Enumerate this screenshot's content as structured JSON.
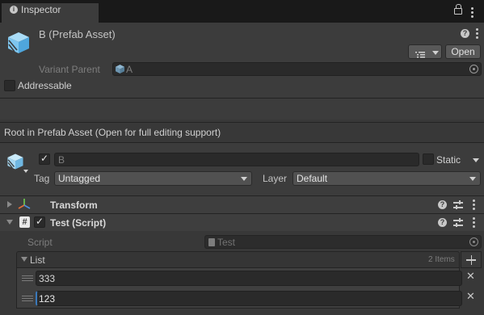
{
  "tab": {
    "title": "Inspector"
  },
  "header": {
    "title": "B (Prefab Asset)",
    "variant_parent_label": "Variant Parent",
    "variant_parent_value": "A",
    "open_button": "Open",
    "addressable_label": "Addressable"
  },
  "notice": "Root in Prefab Asset (Open for full editing support)",
  "gameobject": {
    "name": "B",
    "static_label": "Static",
    "tag_label": "Tag",
    "tag_value": "Untagged",
    "layer_label": "Layer",
    "layer_value": "Default"
  },
  "components": {
    "transform": {
      "title": "Transform"
    },
    "script": {
      "title": "Test (Script)",
      "script_label": "Script",
      "script_value": "Test",
      "list_label": "List",
      "list_count": "2 Items",
      "items": [
        "333",
        "123"
      ]
    }
  },
  "colors": {
    "window_bg": "#383838",
    "header_bg": "#3c3c3c",
    "tabbar_bg": "#191919",
    "field_bg": "#2a2a2a",
    "prefab_blue": "#7ec6ef",
    "focus_blue": "#3a79bb"
  },
  "icons": [
    "info-icon",
    "lock-icon",
    "menu-icon",
    "prefab-icon",
    "help-icon",
    "list-icon",
    "target-icon",
    "transform-icon",
    "script-icon",
    "settings-icon",
    "add-icon",
    "remove-icon",
    "drag-handle-icon"
  ]
}
